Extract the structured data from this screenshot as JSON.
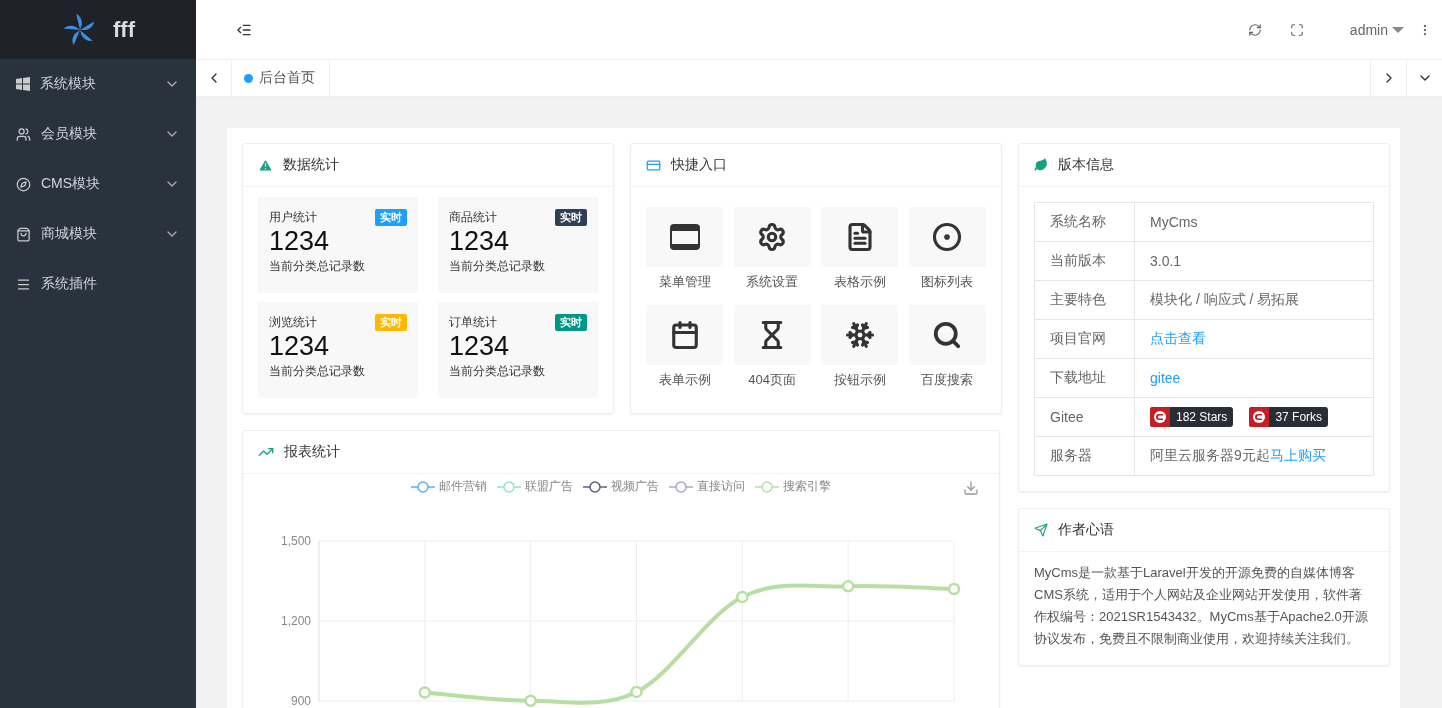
{
  "sidebar": {
    "logo": "fff",
    "items": [
      {
        "label": "系统模块",
        "expandable": true
      },
      {
        "label": "会员模块",
        "expandable": true
      },
      {
        "label": "CMS模块",
        "expandable": true
      },
      {
        "label": "商城模块",
        "expandable": true
      },
      {
        "label": "系统插件",
        "expandable": false
      }
    ]
  },
  "header": {
    "user": "admin"
  },
  "tabs": [
    {
      "label": "后台首页",
      "selected": true
    }
  ],
  "stats": {
    "title": "数据统计",
    "cards": [
      {
        "label": "用户统计",
        "badge": "实时",
        "color": "#1e9fff",
        "value": "1234",
        "note": "当前分类总记录数"
      },
      {
        "label": "商品统计",
        "badge": "实时",
        "color": "#2f4056",
        "value": "1234",
        "note": "当前分类总记录数"
      },
      {
        "label": "浏览统计",
        "badge": "实时",
        "color": "#ffb800",
        "value": "1234",
        "note": "当前分类总记录数"
      },
      {
        "label": "订单统计",
        "badge": "实时",
        "color": "#009688",
        "value": "1234",
        "note": "当前分类总记录数"
      }
    ]
  },
  "shortcuts": {
    "title": "快捷入口",
    "items": [
      {
        "label": "菜单管理"
      },
      {
        "label": "系统设置"
      },
      {
        "label": "表格示例"
      },
      {
        "label": "图标列表"
      },
      {
        "label": "表单示例"
      },
      {
        "label": "404页面"
      },
      {
        "label": "按钮示例"
      },
      {
        "label": "百度搜索"
      }
    ]
  },
  "report": {
    "title": "报表统计",
    "chart_data": {
      "type": "line",
      "grid": true,
      "ylim": [
        900,
        1500
      ],
      "yticks": [
        {
          "value": 900,
          "label": "900"
        },
        {
          "value": 1200,
          "label": "1,200"
        },
        {
          "value": 1500,
          "label": "1,500"
        }
      ],
      "series": [
        {
          "name": "邮件营销",
          "color": "#5ab1ef",
          "values": [
            null,
            null,
            null,
            null,
            null,
            null,
            null
          ]
        },
        {
          "name": "联盟广告",
          "color": "#93e0cc",
          "values": [
            null,
            null,
            null,
            null,
            null,
            null,
            null
          ]
        },
        {
          "name": "视频广告",
          "color": "#5b6179",
          "values": [
            null,
            null,
            null,
            null,
            null,
            null,
            null
          ]
        },
        {
          "name": "直接访问",
          "color": "#a7a7d0",
          "values": [
            null,
            null,
            null,
            null,
            null,
            null,
            null
          ]
        },
        {
          "name": "搜索引擎",
          "color": "#b6e0a3",
          "marker": "circle",
          "values": [
            null,
            932,
            901,
            934,
            1290,
            1330,
            1320
          ]
        }
      ]
    }
  },
  "version": {
    "title": "版本信息",
    "rows": [
      {
        "label": "系统名称",
        "kind": "text",
        "value": "MyCms"
      },
      {
        "label": "当前版本",
        "kind": "text",
        "value": "3.0.1"
      },
      {
        "label": "主要特色",
        "kind": "text",
        "value": "模块化 / 响应式 / 易拓展"
      },
      {
        "label": "项目官网",
        "kind": "link",
        "value": "点击查看"
      },
      {
        "label": "下载地址",
        "kind": "link",
        "value": "gitee"
      },
      {
        "label": "Gitee",
        "kind": "badges",
        "badges": [
          "182 Stars",
          "37 Forks"
        ]
      },
      {
        "label": "服务器",
        "kind": "mixed",
        "value": "阿里云服务器9元起",
        "link": "马上购买"
      }
    ]
  },
  "author": {
    "title": "作者心语",
    "text": "MyCms是一款基于Laravel开发的开源免费的自媒体博客CMS系统，适用于个人网站及企业网站开发使用，软件著作权编号：2021SR1543432。MyCms基于Apache2.0开源协议发布，免费且不限制商业使用，欢迎持续关注我们。"
  }
}
